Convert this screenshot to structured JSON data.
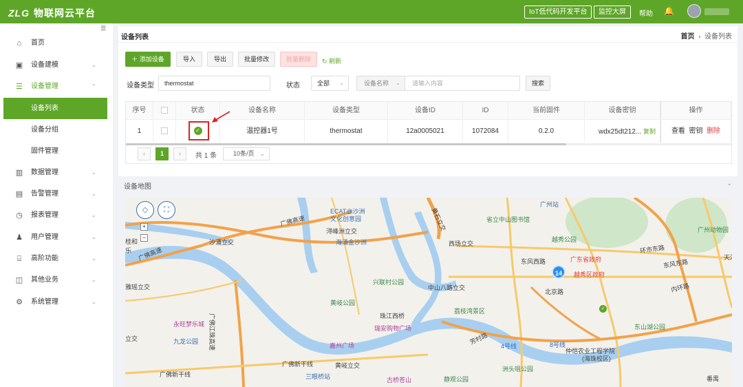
{
  "header": {
    "logo_brand": "ZLG",
    "logo_title": "物联网云平台",
    "iot_btn": "IoT低代码开发平台",
    "screen_btn": "监控大屏",
    "help": "帮助"
  },
  "sidebar": {
    "items": [
      {
        "label": "首页"
      },
      {
        "label": "设备建模"
      },
      {
        "label": "设备管理"
      },
      {
        "label": "数据管理"
      },
      {
        "label": "告警管理"
      },
      {
        "label": "报表管理"
      },
      {
        "label": "用户管理"
      },
      {
        "label": "高阶功能"
      },
      {
        "label": "其他业务"
      },
      {
        "label": "系统管理"
      }
    ],
    "sub": [
      {
        "label": "设备列表"
      },
      {
        "label": "设备分组"
      },
      {
        "label": "固件管理"
      }
    ]
  },
  "page": {
    "title": "设备列表",
    "crumb_home": "首页",
    "crumb_current": "设备列表"
  },
  "toolbar": {
    "add": "添加设备",
    "import": "导入",
    "export": "导出",
    "batch_edit": "批量修改",
    "batch_delete": "批量删除",
    "refresh": "刷新"
  },
  "filters": {
    "type_label": "设备类型",
    "type_value": "thermostat",
    "status_label": "状态",
    "status_value": "全部",
    "name_select": "设备名称",
    "name_placeholder": "请输入内容",
    "search": "搜索"
  },
  "table": {
    "headers": [
      "序号",
      "状态",
      "设备名称",
      "设备类型",
      "设备ID",
      "ID",
      "当前固件",
      "设备密钥",
      "操作"
    ],
    "rows": [
      {
        "index": "1",
        "name": "温控器1号",
        "type": "thermostat",
        "device_id": "12a0005021",
        "id": "1072084",
        "firmware": "0.2.0",
        "key": "wdx25dt212...",
        "copy": "复制",
        "view": "查看",
        "secret": "密钥",
        "delete": "删除"
      }
    ]
  },
  "pager": {
    "prev": "‹",
    "page": "1",
    "next": "›",
    "total": "共 1 条",
    "size": "10条/页"
  },
  "map_section": {
    "title": "设备地图"
  },
  "map": {
    "labels": [
      "ECAT@沙洲",
      "文化创意园",
      "广佛高速",
      "浔峰洲立交",
      "沙涌立交",
      "海涌金沙洲",
      "黄石立交",
      "广州站",
      "广州动物园",
      "越秀公园",
      "西场立交",
      "环市东路",
      "东风西路",
      "广东省政府",
      "东风东路",
      "越秀区政府",
      "天河",
      "内环路",
      "兴联村公园",
      "中山八路立交",
      "广佛江珠高速",
      "荔枝湾景区",
      "珠江西桥",
      "黄岐公园",
      "东山湖公园",
      "芳村路",
      "瑞安购物广场",
      "永旺梦乐城",
      "九龙公园",
      "嘉州广场",
      "仲恺农业工程学院",
      "(海珠校区)",
      "广佛新干线",
      "黄岐立交",
      "三眼桥站",
      "古桥苍山",
      "静观公园",
      "洲头咀公园",
      "雅瑶立交",
      "桂和",
      "乐",
      "广佛高速",
      "立交",
      "番禺",
      "北京路",
      "省立中山图书馆",
      "4号线",
      "8号线",
      "广佛新干线"
    ],
    "cluster_count": "14"
  }
}
